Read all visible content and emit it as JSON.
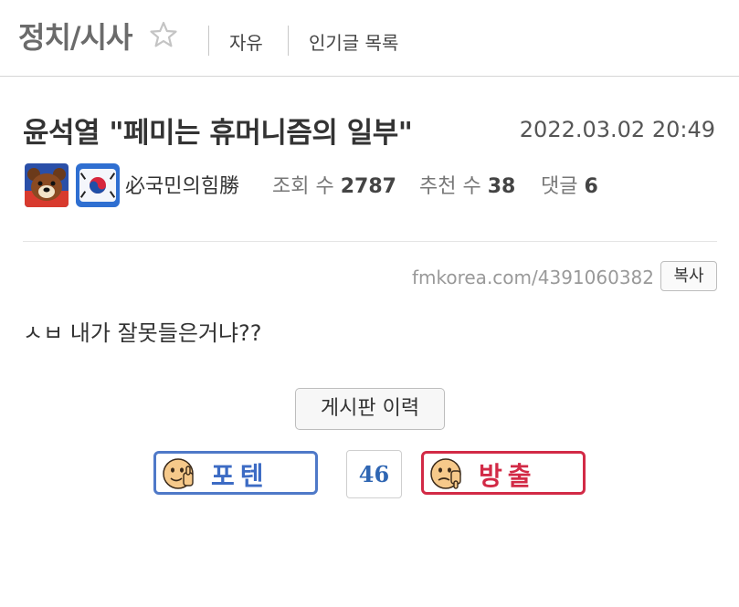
{
  "header": {
    "board_title": "정치/시사",
    "nav": [
      "자유",
      "인기글 목록"
    ]
  },
  "post": {
    "title": "윤석열 \"페미는 휴머니즘의 일부\"",
    "date": "2022.03.02 20:49",
    "author": "必국민의힘勝",
    "stats": {
      "views_label": "조회 수",
      "views": "2787",
      "recommend_label": "추천 수",
      "recommend": "38",
      "comments_label": "댓글",
      "comments": "6"
    },
    "url": "fmkorea.com/4391060382",
    "copy_label": "복사",
    "body": "ㅅㅂ 내가 잘못들은거냐??"
  },
  "actions": {
    "history_label": "게시판 이력",
    "upvote_label": "포텐",
    "downvote_label": "방출",
    "vote_count": "46"
  },
  "colors": {
    "upvote": "#4f79c8",
    "downvote": "#d22a46",
    "count": "#2f66b3"
  }
}
